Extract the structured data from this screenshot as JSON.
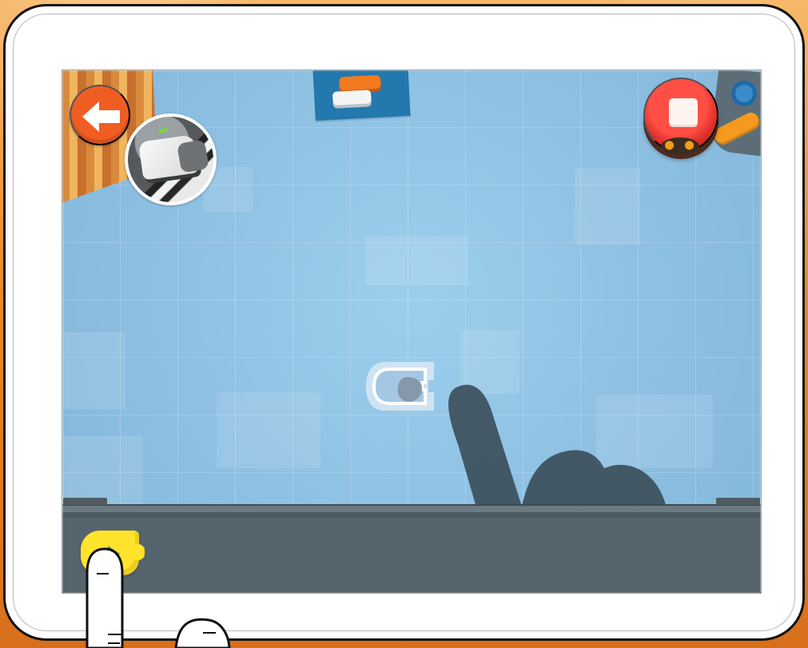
{
  "app": {
    "type": "coding puzzle screen",
    "colors": {
      "background_orange": "#e98727",
      "workspace_blue": "#8fc2e4",
      "back_orange": "#f05d23",
      "stop_red": "#db2e28",
      "start_yellow": "#ffe42b",
      "track_gray": "#56656d",
      "hand_shadow": "#3c4f5c"
    }
  },
  "icons": {
    "back": "left-arrow-icon",
    "robot": "robot-photo-icon",
    "palette": "stacked-blocks-icon",
    "stop": "stop-square-icon",
    "start": "play-triangle-icon",
    "pointer": "pointing-hand-icon"
  },
  "program": {
    "blocks": [
      {
        "name": "start-block",
        "state": "placed"
      },
      {
        "name": "center-block",
        "state": "dragging-hint"
      }
    ]
  }
}
